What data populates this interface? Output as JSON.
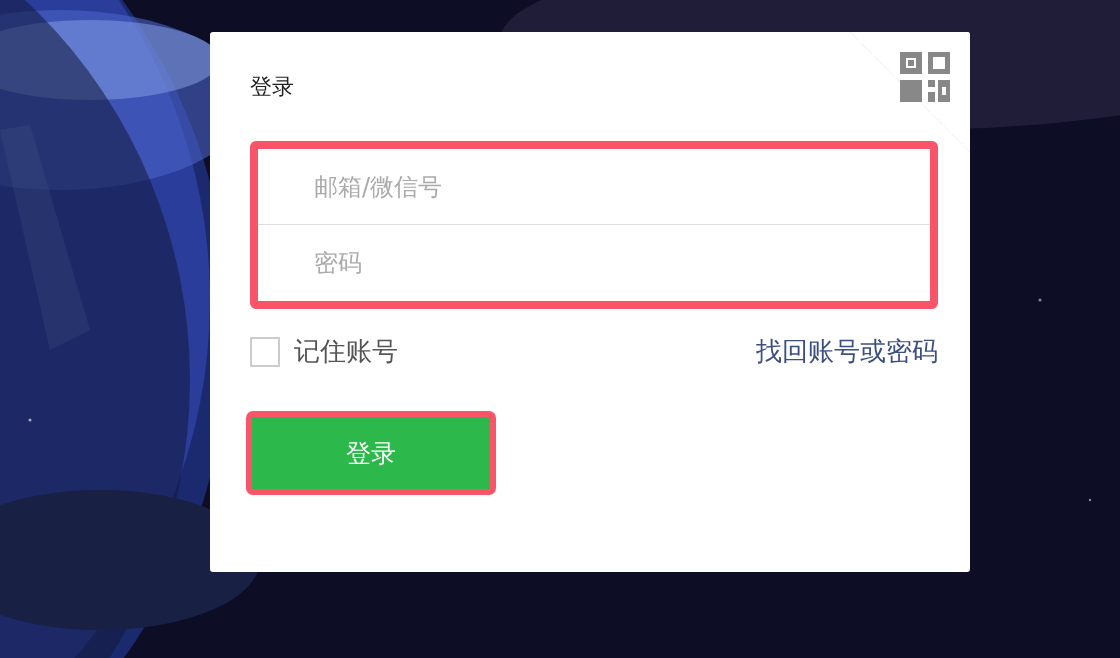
{
  "login": {
    "title": "登录",
    "fields": {
      "highlighted": true,
      "items": [
        {
          "placeholder": "邮箱/微信号"
        },
        {
          "placeholder": "密码"
        }
      ]
    },
    "remember": {
      "label": "记住账号",
      "checked": false
    },
    "recover_link": "找回账号或密码",
    "submit": {
      "label": "登录",
      "highlighted": true
    }
  }
}
